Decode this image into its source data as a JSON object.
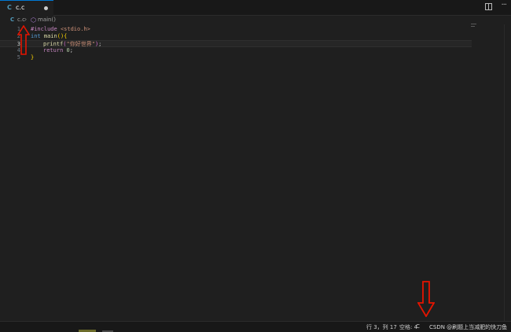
{
  "tab": {
    "icon": "C",
    "label": "c.c"
  },
  "breadcrumb": {
    "icon": "C",
    "file": "c.c",
    "separator": "›",
    "symbol_icon": "⬡",
    "symbol": "main()"
  },
  "editor": {
    "line_numbers": [
      "1",
      "2",
      "3",
      "4",
      "5"
    ],
    "line1": {
      "directive": "#include",
      "header": "<stdio.h>"
    },
    "line2": {
      "type": "int",
      "name": "main",
      "paren_open": "(",
      "paren_close": ")",
      "brace": "{"
    },
    "line3": {
      "fn": "printf",
      "paren_open": "(",
      "string": "\"你好世界\"",
      "paren_close": ")",
      "semi": ";"
    },
    "line4": {
      "kw": "return",
      "num": "0",
      "semi": ";"
    },
    "line5": {
      "brace": "}"
    }
  },
  "statusbar": {
    "position": "行 3，列 17",
    "indent": "空格: 4",
    "language": "C",
    "watermark": "CSDN @刷题上当减肥的快刀鱼"
  },
  "colors": {
    "accent": "#0078d4",
    "annotation_arrow": "#e51400"
  }
}
